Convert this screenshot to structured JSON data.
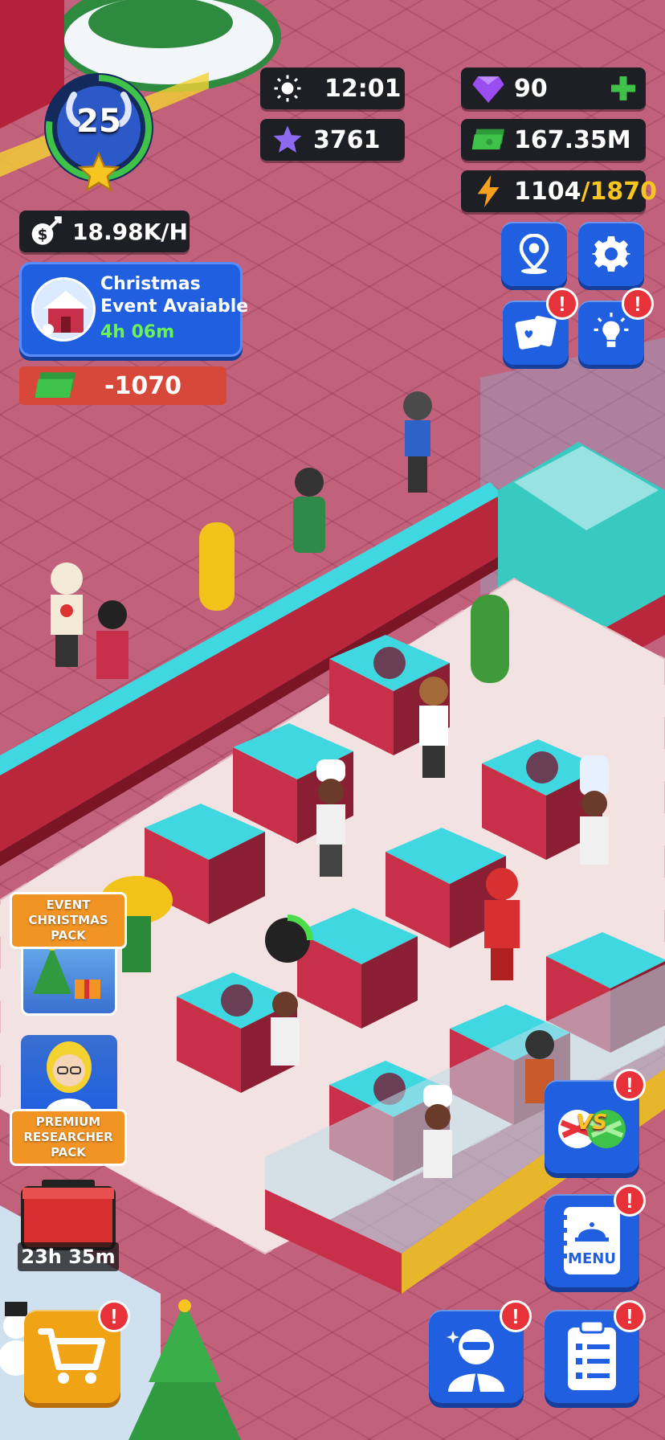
{
  "player": {
    "level": "25"
  },
  "hud": {
    "time": "12:01",
    "stars": "3761",
    "gems": "90",
    "cash": "167.35M",
    "energy_current": "1104",
    "energy_max": "/1870",
    "income_rate": "18.98K/H",
    "cash_change": "-1070"
  },
  "event_banner": {
    "title_line1": "Christmas",
    "title_line2": "Event Avaiable",
    "timer": "4h 06m"
  },
  "offers": {
    "event_pack_label": "EVENT\nCHRISTMAS PACK",
    "researcher_pack_label": "PREMIUM\nRESEARCHER PACK",
    "chest_timer": "23h 35m"
  },
  "buttons": {
    "menu_label": "MENU",
    "vs_label": "VS",
    "alert_mark": "!"
  },
  "colors": {
    "hud_bg": "#1d1f24",
    "button_blue": "#1f5fe0",
    "alert_red": "#e8323a",
    "gem_purple": "#9a4df0",
    "cash_green": "#3fc24a",
    "energy_yellow": "#f7c520",
    "timer_green": "#6cf05a",
    "offer_orange": "#f19424"
  },
  "icons": [
    "sun-icon",
    "star-icon",
    "gem-icon",
    "plus-icon",
    "cash-icon",
    "lightning-icon",
    "money-bag-icon",
    "location-pin-icon",
    "gear-icon",
    "cards-icon",
    "lightbulb-icon",
    "vs-candy-icon",
    "menu-book-icon",
    "manager-icon",
    "clipboard-icon",
    "cart-icon",
    "chest-icon"
  ]
}
